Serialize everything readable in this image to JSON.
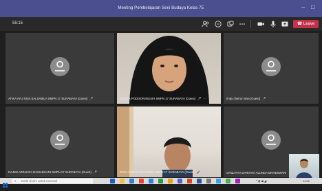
{
  "window": {
    "title": "Meeting Pembelajaran Seni Budaya Kelas 7E",
    "minimize_glyph": "–",
    "maximize_glyph": "□"
  },
  "toolbar": {
    "timer": "55:15",
    "icons": [
      "participants-icon",
      "chat-icon",
      "reactions-icon",
      "more-icon",
      "camera-icon",
      "mic-icon",
      "share-icon"
    ],
    "leave_label": "Leave"
  },
  "participants": [
    {
      "name": "ATIKA AYU NISA SALSABILA SMPN 17 SURABAYA (Guest)",
      "video": false
    },
    {
      "name": "DIVYEA PODISONINGSIH SMPN 17 SURABAYA (Guest)",
      "video": true
    },
    {
      "name": "rindy cheirun nisa (Guest)",
      "video": false
    },
    {
      "name": "NAJMA AZZAHRA RAMADHANI SMPN 17 SURABAYA (Guest)",
      "video": false
    },
    {
      "name": "ERIS AHMAD SYAHRONI SMPN 17 SURABAYA (Guest)",
      "video": true
    },
    {
      "name": "ORIZATHA DARIVITA ALUNDA MAHESWARI",
      "video": false
    }
  ],
  "taskbar": {
    "search_placeholder": "Ketik di sini untuk mencari",
    "time": "14:02"
  },
  "colors": {
    "titlebar": "#4b4e8f",
    "leave": "#c4314b",
    "tile": "#3a3a3a"
  }
}
